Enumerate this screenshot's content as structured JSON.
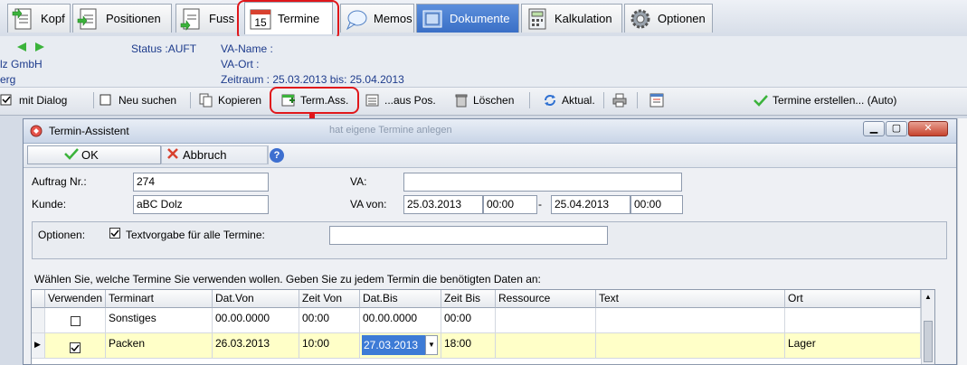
{
  "tabs": [
    {
      "label": "Kopf",
      "icon": "document-arrow-icon"
    },
    {
      "label": "Positionen",
      "icon": "list-arrow-icon"
    },
    {
      "label": "Fuss",
      "icon": "document-arrow-icon"
    },
    {
      "label": "Termine",
      "icon": "calendar-icon",
      "calendar_day": "15"
    },
    {
      "label": "Memos",
      "icon": "speech-bubble-icon"
    },
    {
      "label": "Dokumente",
      "icon": "documents-icon"
    },
    {
      "label": "Kalkulation",
      "icon": "calculator-icon"
    },
    {
      "label": "Optionen",
      "icon": "gear-icon"
    }
  ],
  "header": {
    "company_line1": "lz GmbH",
    "company_line2": "erg",
    "status": "Status :AUFT",
    "va_name_label": "VA-Name :",
    "va_ort_label": "VA-Ort :",
    "zeitraum": "Zeitraum :  25.03.2013   bis: 25.04.2013"
  },
  "toolbar": {
    "mit_dialog": "mit Dialog",
    "neu_suchen": "Neu suchen",
    "kopieren": "Kopieren",
    "term_ass": "Term.Ass.",
    "aus_pos": "...aus Pos.",
    "loeschen": "Löschen",
    "aktual": "Aktual.",
    "termine_erstellen": "Termine erstellen... (Auto)"
  },
  "dialog": {
    "title": "Termin-Assistent",
    "background_hint": "hat eigene Termine anlegen",
    "ok": "OK",
    "abbruch": "Abbruch",
    "help": "?",
    "auftrag_label": "Auftrag Nr.:",
    "auftrag_value": "274",
    "kunde_label": "Kunde:",
    "kunde_value": "aBC Dolz",
    "va_label": "VA:",
    "va_value": "",
    "va_von_label": "VA von:",
    "va_von_date": "25.03.2013",
    "va_von_time": "00:00",
    "dash": "-",
    "va_bis_date": "25.04.2013",
    "va_bis_time": "00:00",
    "optionen_label": "Optionen:",
    "textvorgabe_label": "Textvorgabe für alle Termine:",
    "textvorgabe_value": "",
    "instruction": "Wählen Sie, welche Termine Sie verwenden wollen. Geben Sie zu jedem Termin die benötigten Daten an:"
  },
  "grid": {
    "columns": [
      "Verwenden",
      "Terminart",
      "Dat.Von",
      "Zeit Von",
      "Dat.Bis",
      "Zeit Bis",
      "Ressource",
      "Text",
      "Ort"
    ],
    "rows": [
      {
        "checked": false,
        "terminart": "Sonstiges",
        "dat_von": "00.00.0000",
        "zeit_von": "00:00",
        "dat_bis": "00.00.0000",
        "zeit_bis": "00:00",
        "ressource": "",
        "text": "",
        "ort": ""
      },
      {
        "checked": true,
        "terminart": "Packen",
        "dat_von": "26.03.2013",
        "zeit_von": "10:00",
        "dat_bis": "27.03.2013",
        "zeit_bis": "18:00",
        "ressource": "",
        "text": "",
        "ort": "Lager"
      }
    ]
  },
  "colors": {
    "highlight": "#e0171b",
    "selected_row": "#ffffc8",
    "selected_cell": "#3d7bd6"
  }
}
